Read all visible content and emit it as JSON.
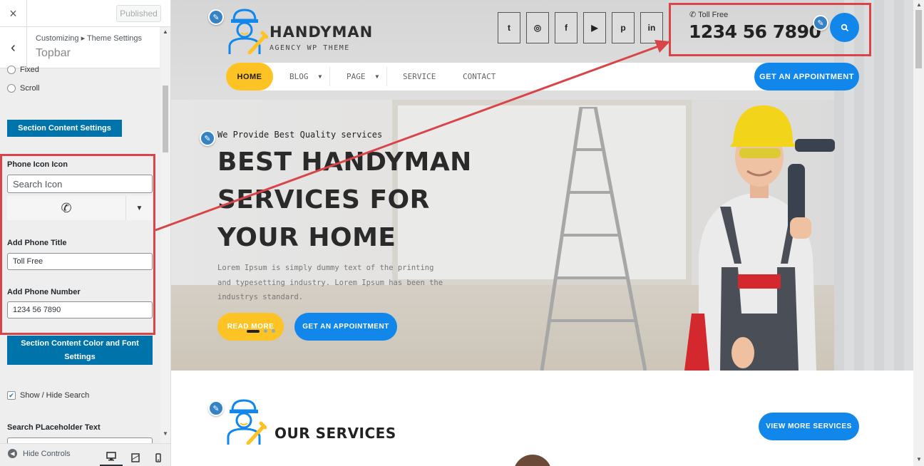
{
  "customizer": {
    "close_icon": "×",
    "published_label": "Published",
    "back_icon": "‹",
    "breadcrumb": "Customizing ▸ Theme Settings",
    "panel_title": "Topbar",
    "radio_options": [
      "Fixed",
      "Scroll"
    ],
    "section_content_button": "Section Content Settings",
    "phone_icon_label": "Phone Icon Icon",
    "icon_search_placeholder": "Search Icon",
    "selected_icon": "phone-volume-icon",
    "phone_title_label": "Add Phone Title",
    "phone_title_value": "Toll Free",
    "phone_number_label": "Add Phone Number",
    "phone_number_value": "1234 56 7890",
    "color_font_button": "Section Content Color and Font Settings",
    "show_hide_search_label": "Show / Hide Search",
    "show_hide_search_checked": true,
    "search_placeholder_label": "Search PLaceholder Text",
    "hide_controls_label": "Hide Controls",
    "devices": [
      "desktop",
      "tablet",
      "mobile"
    ],
    "active_device": "desktop"
  },
  "preview": {
    "brand_name": "HANDYMAN",
    "brand_tagline": "AGENCY WP THEME",
    "social_icons": [
      {
        "name": "twitter-icon",
        "glyph": "t"
      },
      {
        "name": "instagram-icon",
        "glyph": "◎"
      },
      {
        "name": "facebook-icon",
        "glyph": "f"
      },
      {
        "name": "youtube-icon",
        "glyph": "▶"
      },
      {
        "name": "pinterest-icon",
        "glyph": "p"
      },
      {
        "name": "linkedin-icon",
        "glyph": "in"
      }
    ],
    "phone_title": "Toll Free",
    "phone_number": "1234 56 7890",
    "nav": {
      "home": "HOME",
      "blog": "BLOG",
      "page": "PAGE",
      "service": "SERVICE",
      "contact": "CONTACT",
      "cta": "GET AN APPOINTMENT"
    },
    "hero": {
      "subtitle": "We Provide Best Quality services",
      "title": "BEST HANDYMAN SERVICES FOR YOUR HOME",
      "text": "Lorem Ipsum is simply dummy text of the printing and typesetting industry. Lorem Ipsum has been the industrys standard.",
      "read_more": "READ MORE",
      "cta": "GET AN APPOINTMENT",
      "slide_count": 3,
      "active_slide": 1
    },
    "services": {
      "title": "OUR SERVICES",
      "view_more": "VIEW MORE SERVICES"
    }
  },
  "colors": {
    "accent_yellow": "#fdc324",
    "accent_blue": "#1187ec",
    "customizer_blue": "#0073aa",
    "annotation_red": "#d94448"
  }
}
